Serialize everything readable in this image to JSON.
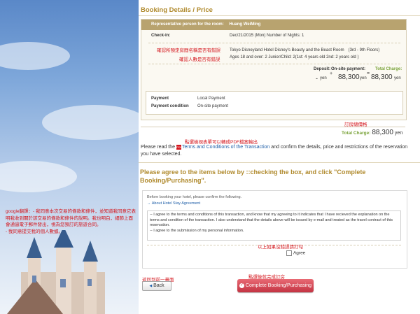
{
  "page_title": "Booking Details / Price",
  "booking": {
    "rep_label": "Representative person for the room:",
    "rep_name": "Huang WeiMing",
    "checkin_label": "Check-in:",
    "checkin_value": "Dec/21/2015 (Mon) Number of Nights: 1",
    "hotel_value": "Tokyo Disneyland Hotel Disney's Beauty and the Beast Room　(3rd - 9th Floors)",
    "guests_value": "Ages 18 and over: 2 Junior/Child: 2(1st: 4 years old 2nd: 2 years old )",
    "deposit_label": "Deposit:",
    "deposit_value": "-",
    "onsite_label": "On-site payment:",
    "onsite_value": "88,300",
    "total_label": "Total Charge:",
    "total_value": "88,300",
    "yen": "yen",
    "plus": "+",
    "equals": "=",
    "payment_label": "Payment",
    "payment_value": "Local Payment",
    "payment_condition_label": "Payment condition",
    "payment_condition_value": "On-site payment"
  },
  "annotations": {
    "confirm_hotel": "確認所預定房間名稱是否有錯誤",
    "confirm_guests": "確認人數是否有錯誤",
    "price_note": "訂房總價格",
    "pdf_note": "點選檢視表單可以轉成PDF檔案輸出",
    "agree_note": "以上如果沒錯誤請打勾",
    "back_note": "返回到前一畫面",
    "complete_note": "點選後就完成訂房",
    "google_translate": "google翻譯：- 我同意本次交易的條款和條件，並知道我同意它表明我收到關於該交易的條款和條件的說明。我也明白，細節上面會通過電子郵件發出，視為您預訂的旅遊合同。\n- 我同意提交我的個人數據。"
  },
  "total": {
    "label": "Total Charge:",
    "value": "88,300",
    "unit": "yen"
  },
  "terms": {
    "prefix": "Please read the",
    "link": "Terms and Conditions of the Transaction",
    "suffix": "and confirm the details, price and restrictions of the reservation you have selected.",
    "pdf_icon": "PDF"
  },
  "agree": {
    "title": "Please agree to the items below by ::checking the box, and click \"Complete Booking/Purchasing\".",
    "before_text": "Before booking your hotel, please confirm the following.",
    "stay_link": "→ About Hotel Stay Agreement",
    "text_line1": "-- I agree to the terms and conditions of this transaction, and know that my agreeing to it indicates that I have recieved the explanation on the terms and condition of the transaction. I also understand that the details above will be issued by e-mail and treated as the travel contract of this reservation.",
    "text_line2": "-- I agree to the submission of my personal information.",
    "checkbox_label": "Agree"
  },
  "buttons": {
    "back": "Back",
    "back_arrow": "◀",
    "complete": "Complete Booking/Purchasing",
    "complete_icon": "✓"
  }
}
